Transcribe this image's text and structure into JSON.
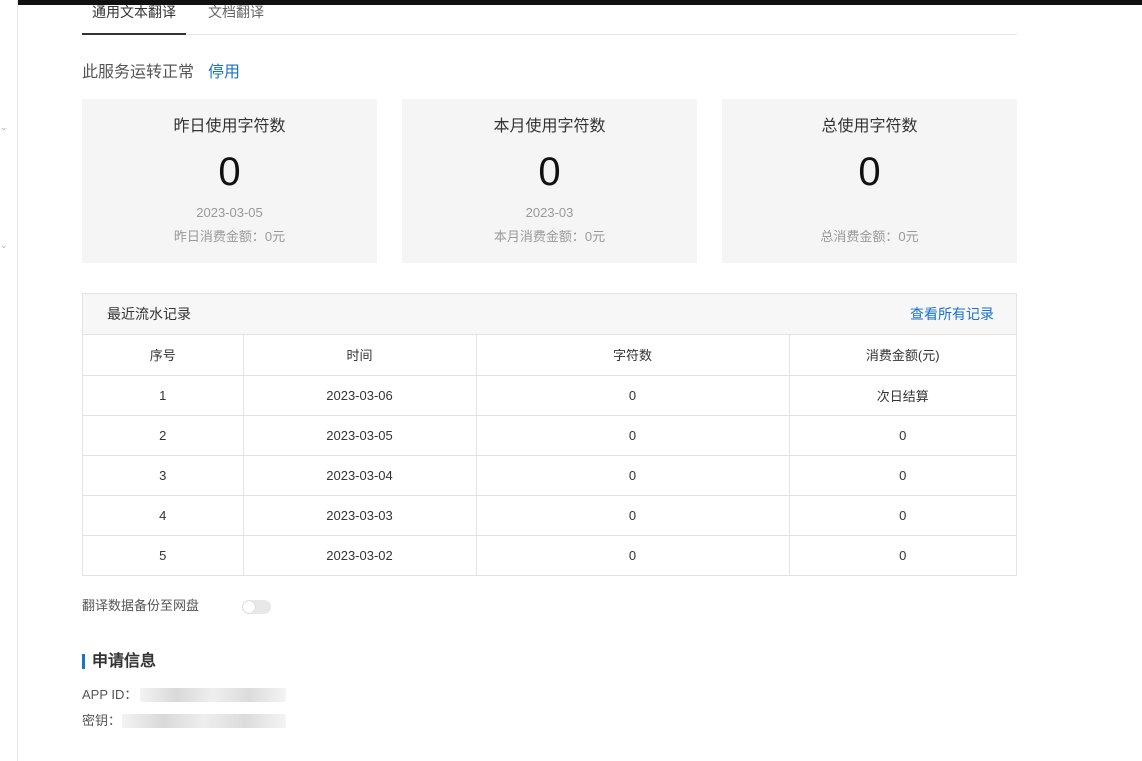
{
  "tabs": [
    {
      "label": "通用文本翻译",
      "active": true
    },
    {
      "label": "文档翻译",
      "active": false
    }
  ],
  "service": {
    "status_text": "此服务运转正常",
    "action_label": "停用"
  },
  "cards": [
    {
      "title": "昨日使用字符数",
      "value": "0",
      "date": "2023-03-05",
      "fee": "昨日消费金额：0元"
    },
    {
      "title": "本月使用字符数",
      "value": "0",
      "date": "2023-03",
      "fee": "本月消费金额：0元"
    },
    {
      "title": "总使用字符数",
      "value": "0",
      "date": "",
      "fee": "总消费金额：0元"
    }
  ],
  "records": {
    "title": "最近流水记录",
    "view_all_label": "查看所有记录",
    "columns": [
      "序号",
      "时间",
      "字符数",
      "消费金额(元)"
    ],
    "rows": [
      [
        "1",
        "2023-03-06",
        "0",
        "次日结算"
      ],
      [
        "2",
        "2023-03-05",
        "0",
        "0"
      ],
      [
        "3",
        "2023-03-04",
        "0",
        "0"
      ],
      [
        "4",
        "2023-03-03",
        "0",
        "0"
      ],
      [
        "5",
        "2023-03-02",
        "0",
        "0"
      ]
    ]
  },
  "backup": {
    "label": "翻译数据备份至网盘",
    "enabled": false
  },
  "application_info": {
    "title": "申请信息",
    "app_id_label": "APP ID：",
    "secret_label": "密钥："
  },
  "icons": {
    "rail": "chevron-down-icon"
  },
  "colors": {
    "accent": "#1a73c9",
    "card_background": "#f5f5f5"
  }
}
